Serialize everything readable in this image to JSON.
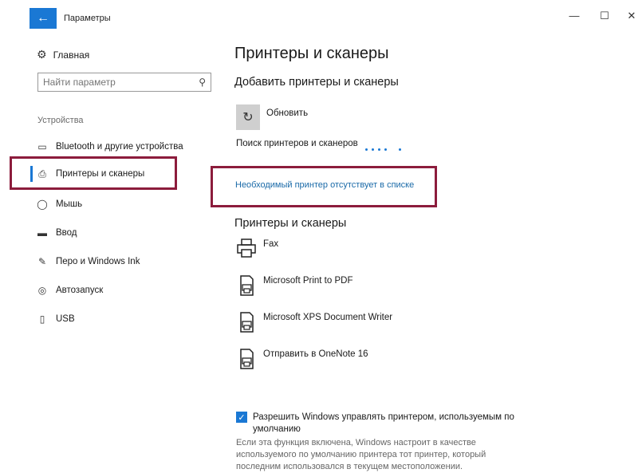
{
  "window": {
    "title": "Параметры",
    "back_glyph": "←",
    "minimize": "—",
    "maximize": "☐",
    "close": "✕"
  },
  "sidebar": {
    "home_label": "Главная",
    "search_placeholder": "Найти параметр",
    "section_label": "Устройства",
    "items": [
      {
        "label": "Bluetooth и другие устройства",
        "icon": "bluetooth-devices-icon"
      },
      {
        "label": "Принтеры и сканеры",
        "icon": "printer-icon",
        "selected": true
      },
      {
        "label": "Мышь",
        "icon": "mouse-icon"
      },
      {
        "label": "Ввод",
        "icon": "keyboard-icon"
      },
      {
        "label": "Перо и Windows Ink",
        "icon": "pen-icon"
      },
      {
        "label": "Автозапуск",
        "icon": "autoplay-icon"
      },
      {
        "label": "USB",
        "icon": "usb-icon"
      }
    ]
  },
  "main": {
    "title": "Принтеры и сканеры",
    "add_heading": "Добавить принтеры и сканеры",
    "refresh_label": "Обновить",
    "searching_text": "Поиск принтеров и сканеров",
    "missing_link": "Необходимый принтер отсутствует в списке",
    "list_heading": "Принтеры и сканеры",
    "printers": [
      {
        "name": "Fax",
        "icon": "fax-printer-icon"
      },
      {
        "name": "Microsoft Print to PDF",
        "icon": "document-printer-icon"
      },
      {
        "name": "Microsoft XPS Document Writer",
        "icon": "document-printer-icon"
      },
      {
        "name": "Отправить в OneNote 16",
        "icon": "document-printer-icon"
      }
    ],
    "default_checkbox_label": "Разрешить Windows управлять принтером, используемым по умолчанию",
    "default_checkbox_checked": true,
    "default_description": "Если эта функция включена, Windows настроит в качестве используемого по умолчанию принтера тот принтер, который последним использовался в текущем местоположении."
  },
  "colors": {
    "accent": "#1a78d4",
    "highlight_border": "#8c1c3c",
    "link": "#1a6aa8"
  }
}
